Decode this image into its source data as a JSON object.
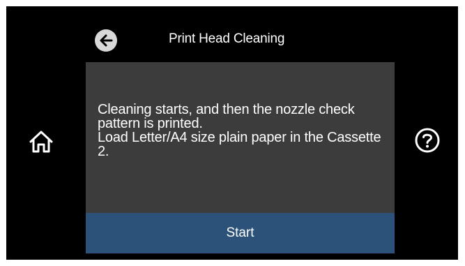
{
  "header": {
    "title": "Print Head Cleaning",
    "back_icon": "arrow-left-icon"
  },
  "dialog": {
    "message_lines": [
      "Cleaning starts, and then the nozzle check pattern is printed.",
      "Load Letter/A4 size plain paper in the Cassette 2."
    ],
    "start_label": "Start"
  },
  "side": {
    "home_icon": "home-icon",
    "help_icon": "question-mark-icon"
  },
  "colors": {
    "background": "#000000",
    "dialog": "#3c3c3c",
    "start_button": "#2d527a",
    "text": "#ffffff",
    "back_circle": "#d8d8d8"
  }
}
